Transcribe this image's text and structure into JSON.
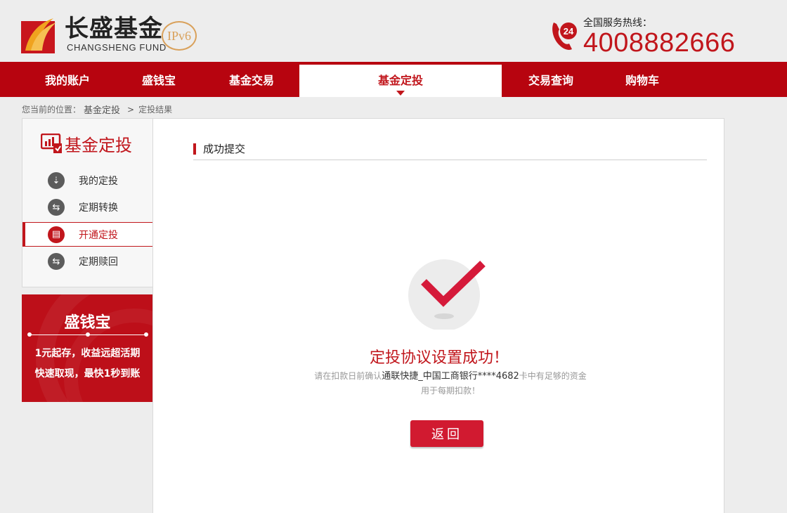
{
  "header": {
    "logo_cn": "长盛基金",
    "logo_en": "CHANGSHENG FUND",
    "logo_badge": "IPv6",
    "hotline_label": "全国服务热线：",
    "hotline_number": "4008882666",
    "hotline_icon_text": "24"
  },
  "nav": {
    "items": [
      {
        "label": "我的账户"
      },
      {
        "label": "盛钱宝"
      },
      {
        "label": "基金交易"
      },
      {
        "label": "基金定投"
      },
      {
        "label": "交易查询"
      },
      {
        "label": "购物车"
      }
    ],
    "active_index": 3
  },
  "breadcrumb": {
    "prefix": "您当前的位置：",
    "parent": "基金定投",
    "separator": ">",
    "current": "定投结果"
  },
  "sidebar": {
    "title": "基金定投",
    "items": [
      {
        "label": "我的定投",
        "icon": "download-arrow-icon",
        "glyph": "⇣"
      },
      {
        "label": "定期转换",
        "icon": "swap-arrows-icon",
        "glyph": "⇆"
      },
      {
        "label": "开通定投",
        "icon": "calendar-icon",
        "glyph": "▤"
      },
      {
        "label": "定期赎回",
        "icon": "swap-arrows-icon",
        "glyph": "⇆"
      }
    ],
    "active_index": 2
  },
  "promo": {
    "title": "盛钱宝",
    "line1": "1元起存，收益远超活期",
    "line2": "快速取现，最快1秒到账"
  },
  "main": {
    "section_title": "成功提交",
    "success_title": "定投协议设置成功！",
    "desc_pre": "请在扣款日前确认",
    "desc_account": "通联快捷_中国工商银行****4682",
    "desc_post": "卡中有足够的资金用于每期扣款！",
    "back_label": "返回"
  },
  "colors": {
    "brand_red": "#b7040f",
    "accent_red": "#c1161c",
    "button_red": "#d11a30"
  }
}
